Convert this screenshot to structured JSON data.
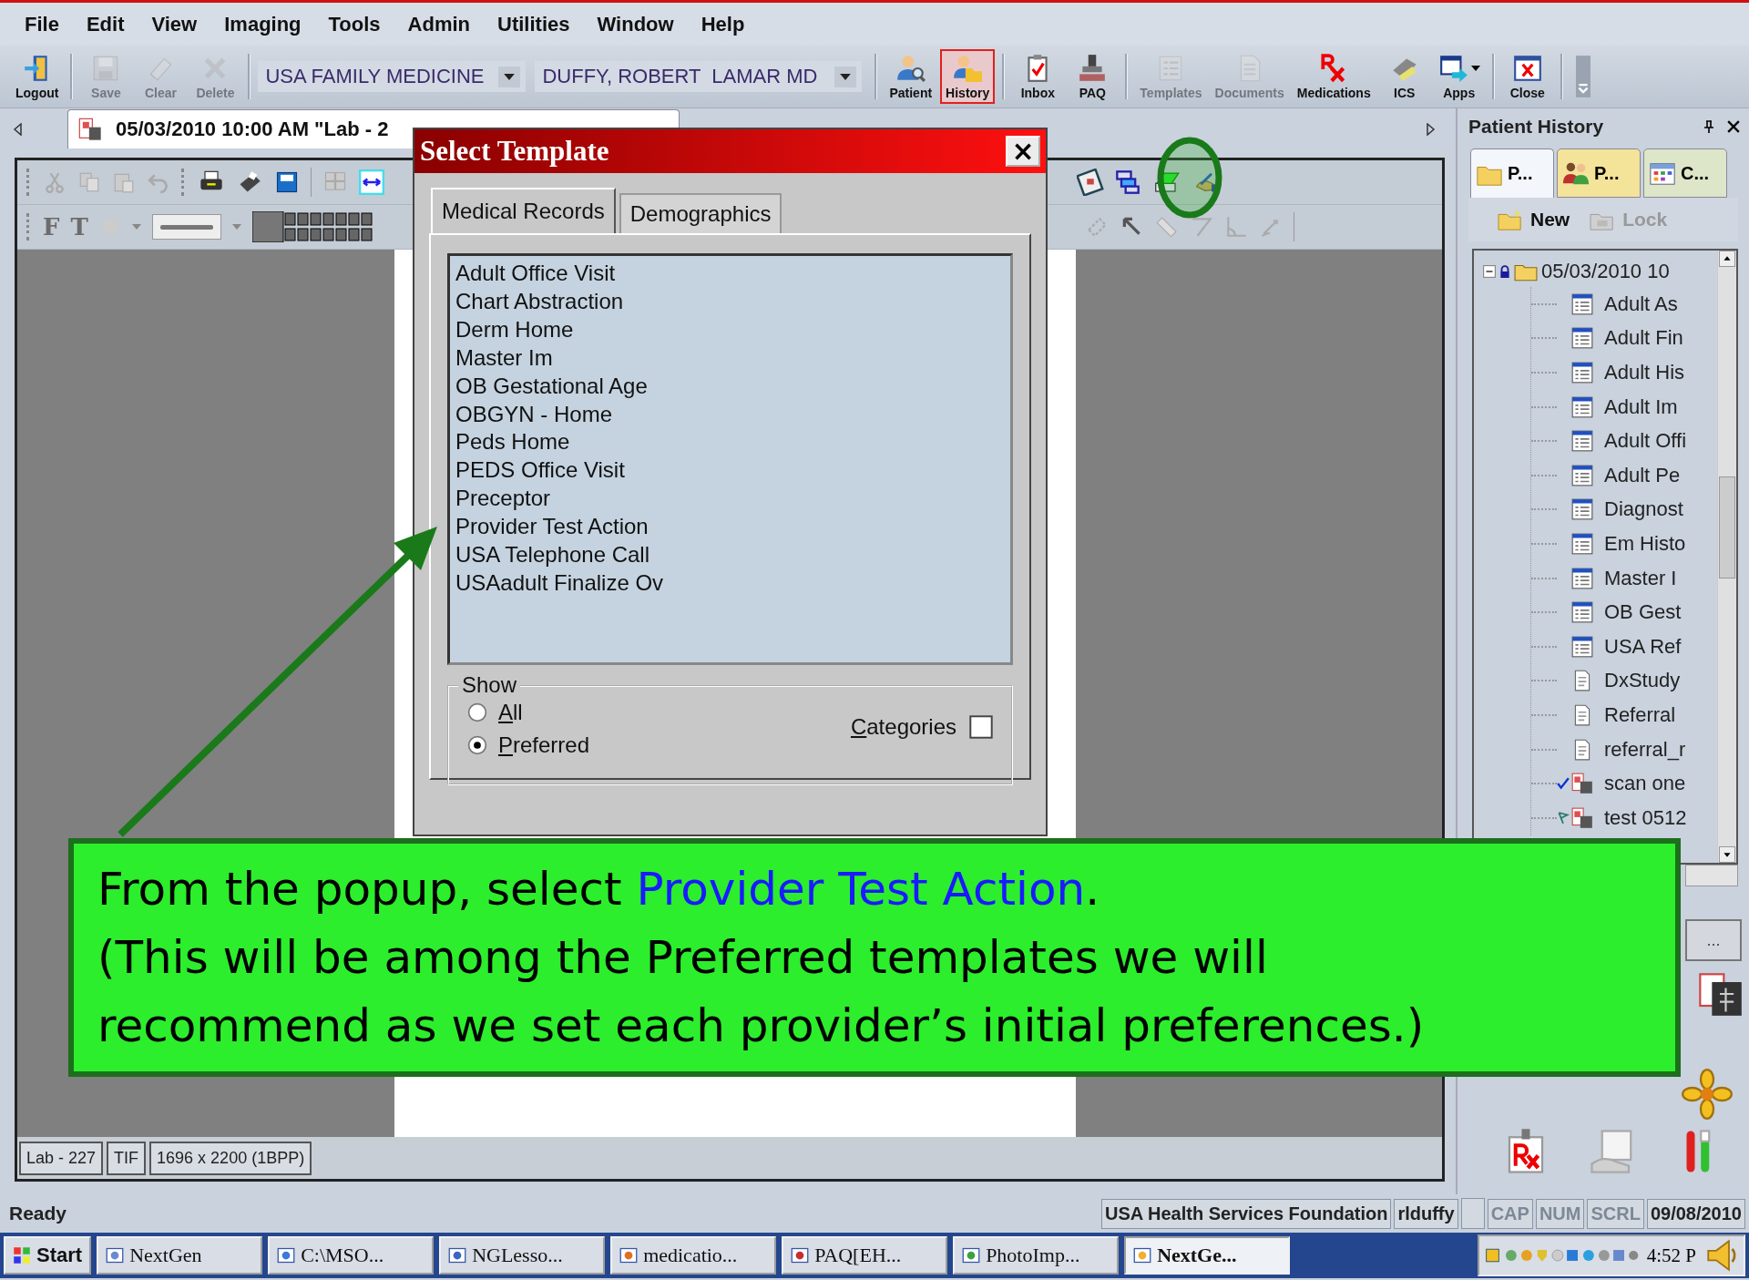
{
  "menu": [
    "File",
    "Edit",
    "View",
    "Imaging",
    "Tools",
    "Admin",
    "Utilities",
    "Window",
    "Help"
  ],
  "toolbar": {
    "groups": [
      [
        {
          "kind": "button",
          "label": "Logout",
          "disabled": false,
          "selected": false,
          "has_menu": false
        }
      ],
      [
        {
          "kind": "button",
          "label": "Save",
          "disabled": true,
          "selected": false,
          "has_menu": false
        },
        {
          "kind": "button",
          "label": "Clear",
          "disabled": true,
          "selected": false,
          "has_menu": false
        },
        {
          "kind": "button",
          "label": "Delete",
          "disabled": true,
          "selected": false,
          "has_menu": false
        }
      ],
      [
        {
          "kind": "dropdown",
          "value": "USA FAMILY MEDICINE"
        },
        {
          "kind": "dropdown",
          "value": "DUFFY, ROBERT  LAMAR MD"
        }
      ],
      [
        {
          "kind": "button",
          "label": "Patient",
          "disabled": false,
          "selected": false,
          "has_menu": false
        },
        {
          "kind": "button",
          "label": "History",
          "disabled": false,
          "selected": true,
          "has_menu": false
        }
      ],
      [
        {
          "kind": "button",
          "label": "Inbox",
          "disabled": false,
          "selected": false,
          "has_menu": false
        },
        {
          "kind": "button",
          "label": "PAQ",
          "disabled": false,
          "selected": false,
          "has_menu": false
        }
      ],
      [
        {
          "kind": "button",
          "label": "Templates",
          "disabled": true,
          "selected": false,
          "has_menu": false
        },
        {
          "kind": "button",
          "label": "Documents",
          "disabled": true,
          "selected": false,
          "has_menu": false
        },
        {
          "kind": "button",
          "label": "Medications",
          "disabled": false,
          "selected": false,
          "has_menu": false
        },
        {
          "kind": "button",
          "label": "ICS",
          "disabled": false,
          "selected": false,
          "has_menu": false
        },
        {
          "kind": "button",
          "label": "Apps",
          "disabled": false,
          "selected": false,
          "has_menu": true
        }
      ],
      [
        {
          "kind": "button",
          "label": "Close",
          "disabled": false,
          "selected": false,
          "has_menu": false
        }
      ]
    ]
  },
  "image_toolbar": {
    "glyphs": [
      "F",
      "T"
    ]
  },
  "document_tab": {
    "title": "05/03/2010 10:00 AM \"Lab - 2"
  },
  "image_info": [
    "Lab - 227",
    "TIF",
    "1696 x 2200 (1BPP)"
  ],
  "dialog": {
    "title": "Select Template",
    "close": "×",
    "tabs": [
      {
        "label": "Medical Records",
        "selected": true
      },
      {
        "label": "Demographics",
        "selected": false
      }
    ],
    "templates": [
      {
        "name": "Adult Office Visit",
        "selected": false
      },
      {
        "name": "Chart Abstraction",
        "selected": false
      },
      {
        "name": "Derm Home",
        "selected": false
      },
      {
        "name": "Master Im",
        "selected": false
      },
      {
        "name": "OB Gestational Age",
        "selected": false
      },
      {
        "name": "OBGYN - Home",
        "selected": false
      },
      {
        "name": "Peds Home",
        "selected": false
      },
      {
        "name": "PEDS Office Visit",
        "selected": false
      },
      {
        "name": "Preceptor",
        "selected": false
      },
      {
        "name": "Provider Test Action",
        "selected": false
      },
      {
        "name": "USA Telephone Call",
        "selected": false
      },
      {
        "name": "USAadult Finalize Ov",
        "selected": false
      }
    ],
    "show": {
      "legend": "Show",
      "options": [
        {
          "label": "All",
          "selected": false
        },
        {
          "label": "Preferred",
          "selected": true
        }
      ],
      "categories": {
        "label": "Categories",
        "checked": false
      }
    }
  },
  "patient_history": {
    "title": "Patient History",
    "tabs": [
      {
        "label": "P...",
        "selected": true
      },
      {
        "label": "P...",
        "selected": false
      },
      {
        "label": "C...",
        "selected": false
      }
    ],
    "actions": [
      {
        "label": "New",
        "disabled": false
      },
      {
        "label": "Lock",
        "disabled": true
      }
    ],
    "tree": {
      "label": "05/03/2010 10",
      "expanded": true,
      "locked": true,
      "children": [
        {
          "label": "Adult As",
          "kind": "template",
          "checked": false,
          "flagged": false
        },
        {
          "label": "Adult Fin",
          "kind": "template",
          "checked": false,
          "flagged": false
        },
        {
          "label": "Adult His",
          "kind": "template",
          "checked": false,
          "flagged": false
        },
        {
          "label": "Adult Im",
          "kind": "template",
          "checked": false,
          "flagged": false
        },
        {
          "label": "Adult Offi",
          "kind": "template",
          "checked": false,
          "flagged": false
        },
        {
          "label": "Adult Pe",
          "kind": "template",
          "checked": false,
          "flagged": false
        },
        {
          "label": "Diagnost",
          "kind": "template",
          "checked": false,
          "flagged": false
        },
        {
          "label": "Em Histo",
          "kind": "template",
          "checked": false,
          "flagged": false
        },
        {
          "label": "Master I",
          "kind": "template",
          "checked": false,
          "flagged": false
        },
        {
          "label": "OB Gest",
          "kind": "template",
          "checked": false,
          "flagged": false
        },
        {
          "label": "USA Ref",
          "kind": "template",
          "checked": false,
          "flagged": false
        },
        {
          "label": "DxStudy",
          "kind": "document",
          "checked": false,
          "flagged": false
        },
        {
          "label": "Referral",
          "kind": "document",
          "checked": false,
          "flagged": false
        },
        {
          "label": "referral_r",
          "kind": "document",
          "checked": false,
          "flagged": false
        },
        {
          "label": "scan one",
          "kind": "image",
          "checked": true,
          "flagged": false
        },
        {
          "label": "test 0512",
          "kind": "image",
          "checked": false,
          "flagged": true
        }
      ]
    },
    "more_button": "..."
  },
  "callout": {
    "lines": [
      [
        {
          "text": "From the popup, select ",
          "highlight": false
        },
        {
          "text": "Provider Test Action",
          "highlight": true
        },
        {
          "text": ".",
          "highlight": false
        }
      ],
      [
        {
          "text": "(This will be among the Preferred templates we will",
          "highlight": false
        }
      ],
      [
        {
          "text": "recommend as we set each provider’s initial preferences.)",
          "highlight": false
        }
      ]
    ]
  },
  "status_bar": {
    "message": "Ready",
    "panels": [
      {
        "text": "USA Health Services Foundation",
        "disabled": false
      },
      {
        "text": "rlduffy",
        "disabled": false
      },
      {
        "text": "CAP",
        "disabled": true
      },
      {
        "text": "NUM",
        "disabled": true
      },
      {
        "text": "SCRL",
        "disabled": true
      },
      {
        "text": "09/08/2010",
        "disabled": false
      }
    ]
  },
  "taskbar": {
    "start": "Start",
    "items": [
      {
        "label": "NextGen",
        "selected": false
      },
      {
        "label": "C:\\MSO...",
        "selected": false
      },
      {
        "label": "NGLesso...",
        "selected": false
      },
      {
        "label": "medicatio...",
        "selected": false
      },
      {
        "label": "PAQ[EH...",
        "selected": false
      },
      {
        "label": "PhotoImp...",
        "selected": false
      },
      {
        "label": "NextGe...",
        "selected": true
      }
    ],
    "clock": "4:52 P"
  }
}
